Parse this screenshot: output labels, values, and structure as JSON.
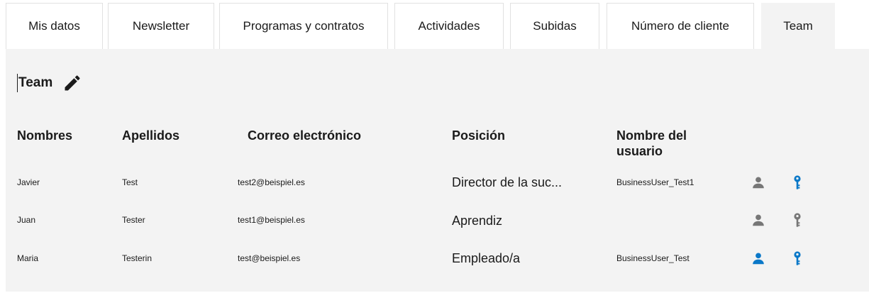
{
  "tabs": [
    {
      "label": "Mis datos"
    },
    {
      "label": "Newsletter"
    },
    {
      "label": "Programas y contratos"
    },
    {
      "label": "Actividades"
    },
    {
      "label": "Subidas"
    },
    {
      "label": "Número de cliente"
    },
    {
      "label": "Team"
    }
  ],
  "team": {
    "title": "Team",
    "columns": {
      "first_name": "Nombres",
      "last_name": "Apellidos",
      "email": "Correo electrónico",
      "position": "Posición",
      "username_line1": "Nombre del",
      "username_line2": "usuario"
    },
    "rows": [
      {
        "first_name": "Javier",
        "last_name": "Test",
        "email": "test2@beispiel.es",
        "position": "Director de la suc...",
        "username": "BusinessUser_Test1",
        "user_icon": "user-icon",
        "user_icon_color": "#767676",
        "key_icon": "key-icon",
        "key_icon_color": "#0a78c8"
      },
      {
        "first_name": "Juan",
        "last_name": "Tester",
        "email": "test1@beispiel.es",
        "position": "Aprendiz",
        "username": "",
        "user_icon": "user-icon",
        "user_icon_color": "#767676",
        "key_icon": "key-icon",
        "key_icon_color": "#767676"
      },
      {
        "first_name": "Maria",
        "last_name": "Testerin",
        "email": "test@beispiel.es",
        "position": "Empleado/a",
        "username": "BusinessUser_Test",
        "user_icon": "user-icon",
        "user_icon_color": "#0a78c8",
        "key_icon": "key-icon",
        "key_icon_color": "#0a78c8"
      }
    ]
  },
  "colors": {
    "accent": "#0a78c8",
    "inactive_icon": "#767676",
    "panel_bg": "#f3f3f3"
  }
}
